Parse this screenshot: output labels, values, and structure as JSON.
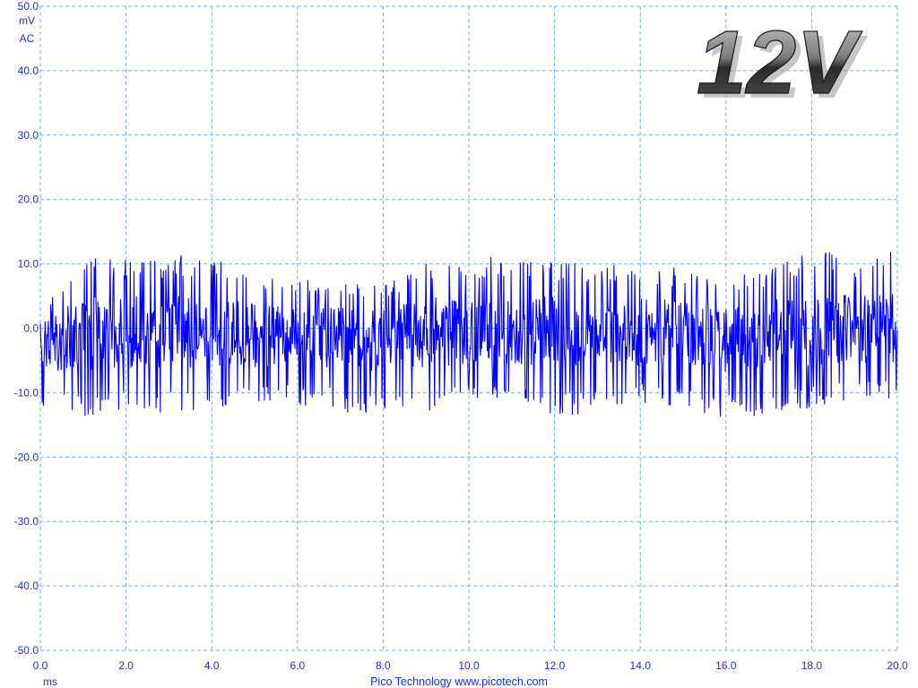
{
  "chart_data": {
    "type": "line",
    "title": "",
    "badge": "12V",
    "y_unit": "mV",
    "y_coupling": "AC",
    "x_unit": "ms",
    "xlim": [
      0.0,
      20.0
    ],
    "ylim": [
      -50.0,
      50.0
    ],
    "x_ticks": [
      "0.0",
      "2.0",
      "4.0",
      "6.0",
      "8.0",
      "10.0",
      "12.0",
      "14.0",
      "16.0",
      "18.0",
      "20.0"
    ],
    "y_ticks": [
      "50.0",
      "40.0",
      "30.0",
      "20.0",
      "10.0",
      "0.0",
      "-10.0",
      "-20.0",
      "-30.0",
      "-40.0",
      "-50.0"
    ],
    "grid": true,
    "credit": "Pico Technology  www.picotech.com",
    "series": [
      {
        "color": "#0000ff",
        "signal": "noise",
        "sample_count": 1400,
        "envelope": {
          "x": [
            0.0,
            1.0,
            2.0,
            3.0,
            4.0,
            5.0,
            6.0,
            7.0,
            8.0,
            9.0,
            10.0,
            11.0,
            12.0,
            13.0,
            14.0,
            15.0,
            16.0,
            17.0,
            18.0,
            19.0,
            20.0
          ],
          "max": [
            3.0,
            10.0,
            10.0,
            10.5,
            10.0,
            8.0,
            7.0,
            6.5,
            6.0,
            9.5,
            10.0,
            10.5,
            10.0,
            9.0,
            9.5,
            8.5,
            7.0,
            8.5,
            11.0,
            10.5,
            11.5
          ],
          "min": [
            -13.5,
            -13.0,
            -12.5,
            -12.5,
            -12.0,
            -12.0,
            -11.5,
            -12.5,
            -14.0,
            -12.5,
            -11.5,
            -11.0,
            -13.0,
            -12.5,
            -11.5,
            -12.0,
            -13.5,
            -13.0,
            -12.0,
            -11.0,
            -10.5
          ]
        }
      }
    ]
  }
}
